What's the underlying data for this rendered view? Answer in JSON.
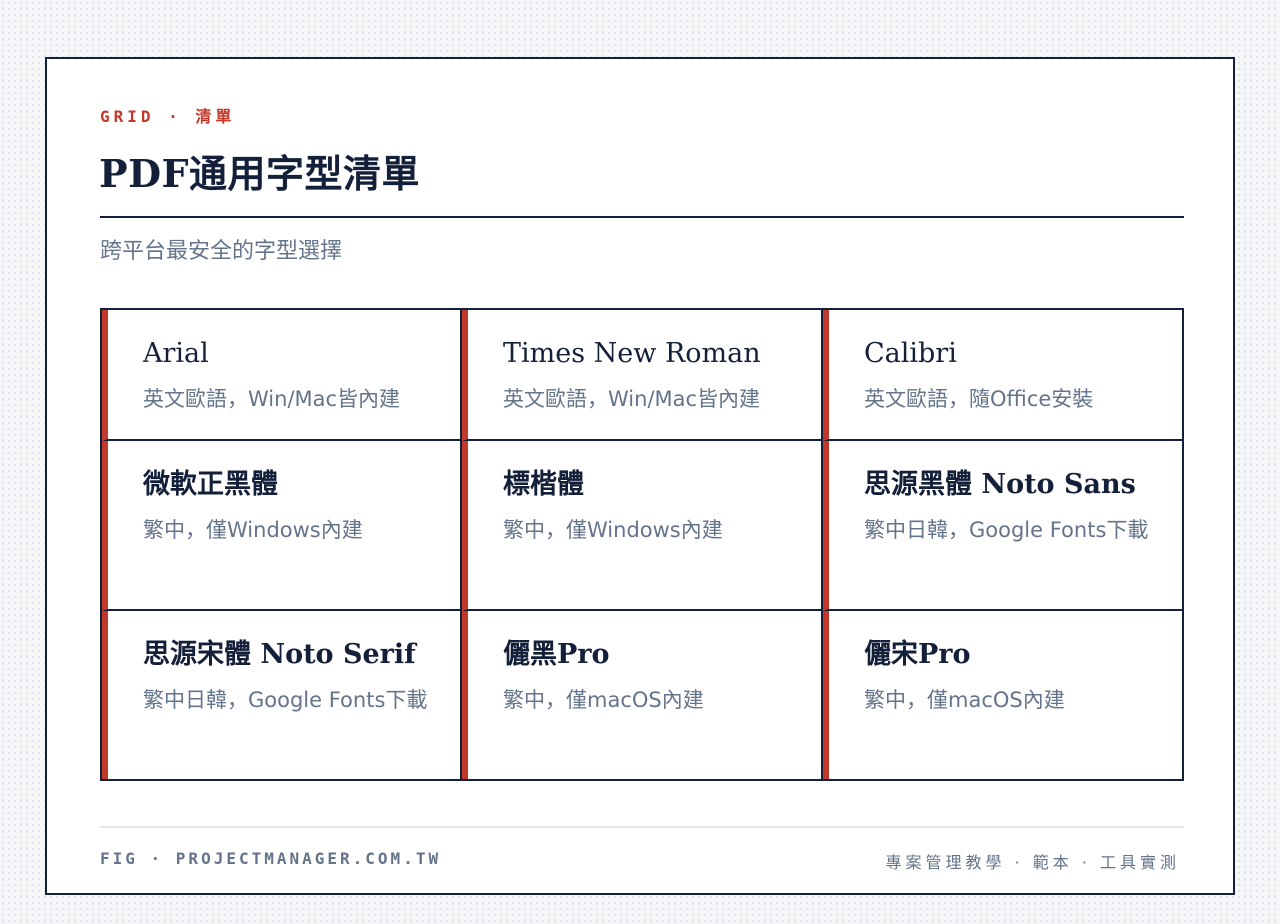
{
  "header": {
    "eyebrow": "GRID · 清單",
    "title": "PDF通用字型清單",
    "subtitle": "跨平台最安全的字型選擇"
  },
  "fonts": [
    {
      "name": "Arial",
      "desc": "英文歐語，Win/Mac皆內建"
    },
    {
      "name": "Times New Roman",
      "desc": "英文歐語，Win/Mac皆內建"
    },
    {
      "name": "Calibri",
      "desc": "英文歐語，隨Office安裝"
    },
    {
      "name": "微軟正黑體",
      "desc": "繁中，僅Windows內建"
    },
    {
      "name": "標楷體",
      "desc": "繁中，僅Windows內建"
    },
    {
      "name": "思源黑體 Noto Sans",
      "desc": "繁中日韓，Google Fonts下載"
    },
    {
      "name": "思源宋體 Noto Serif",
      "desc": "繁中日韓，Google Fonts下載"
    },
    {
      "name": "儷黑Pro",
      "desc": "繁中，僅macOS內建"
    },
    {
      "name": "儷宋Pro",
      "desc": "繁中，僅macOS內建"
    }
  ],
  "footer": {
    "left": "FIG · PROJECTMANAGER.COM.TW",
    "right": "專案管理教學 · 範本 · 工具實測"
  },
  "colors": {
    "accent": "#c0392b",
    "ink": "#14203a",
    "muted": "#64748b"
  }
}
